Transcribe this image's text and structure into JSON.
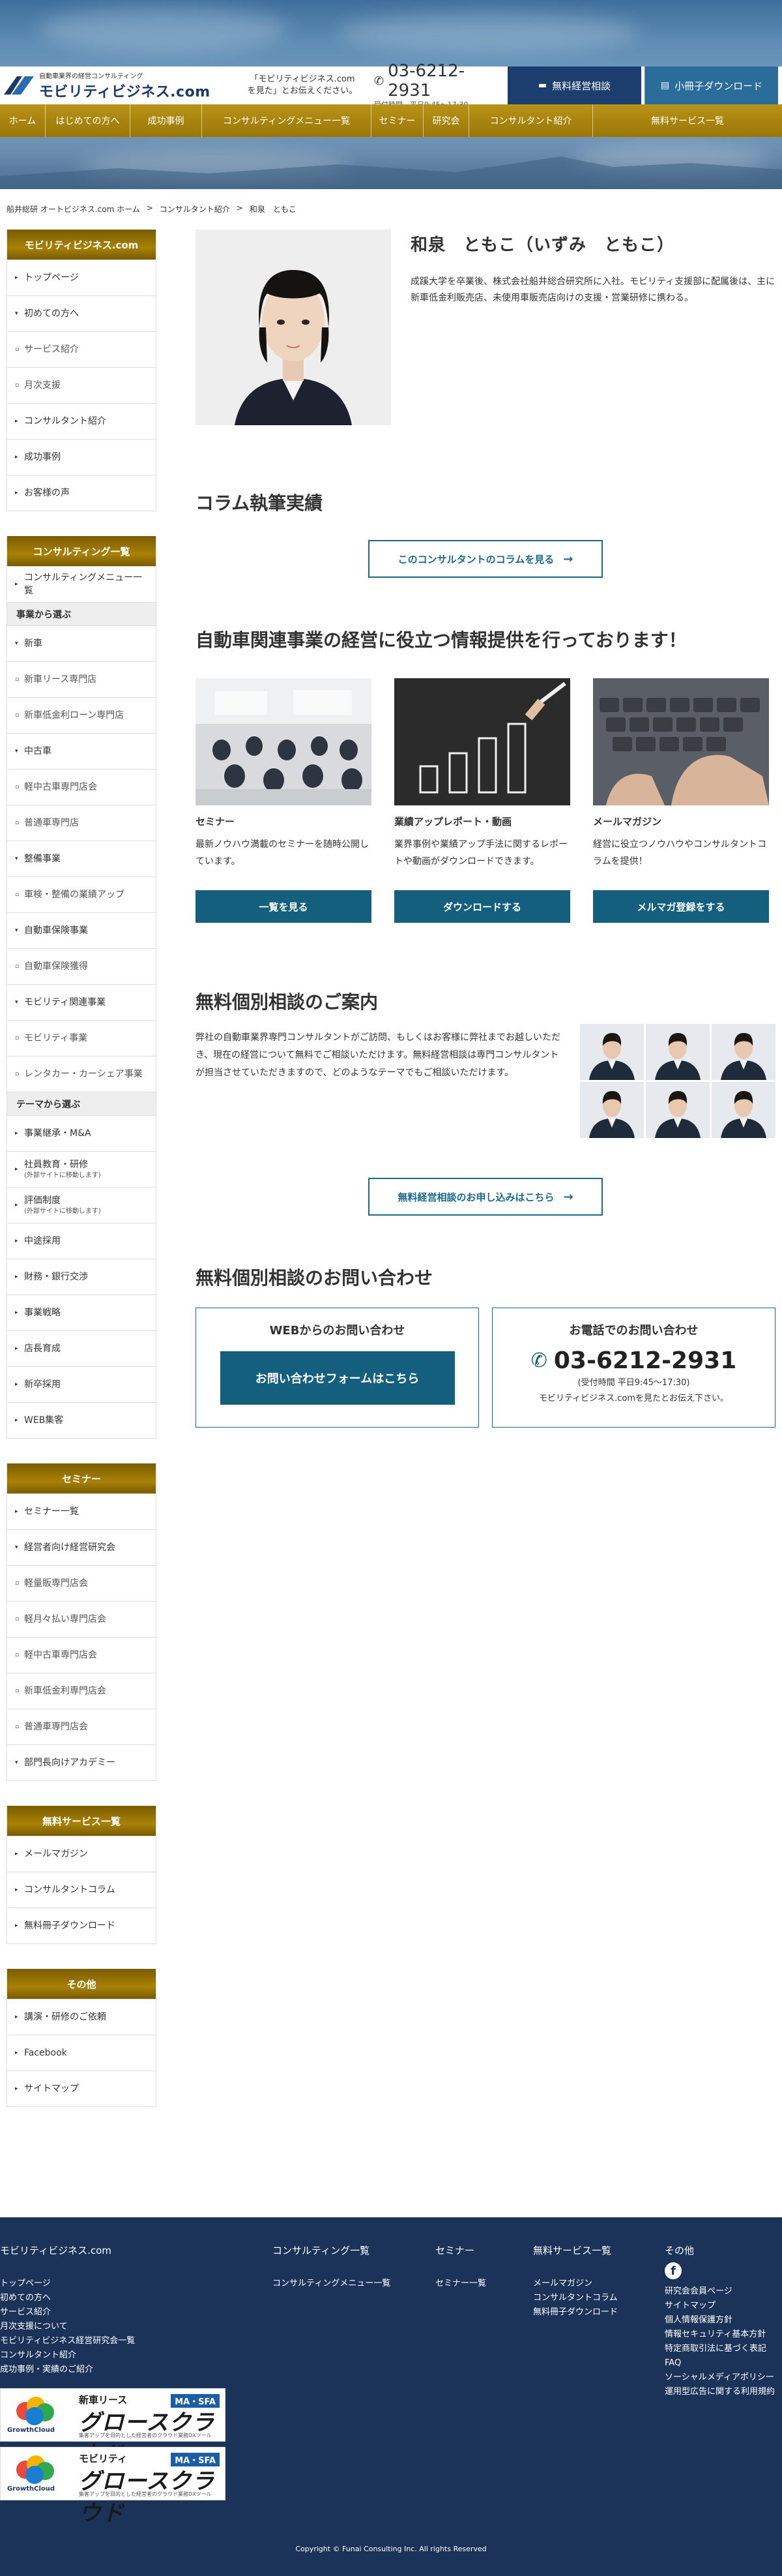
{
  "header": {
    "logo_sub": "自動車業界の経営コンサルティング",
    "logo_main": "モビリティビジネス.com",
    "note_line1": "「モビリティビジネス.com",
    "note_line2": "を見た」とお伝えください。",
    "tel": "03-6212-2931",
    "hours": "受付時間　平日9:45〜17:30",
    "consult_btn": "無料経営相談",
    "dl_btn": "小冊子ダウンロード"
  },
  "gnav": [
    "ホーム",
    "はじめての方へ",
    "成功事例",
    "コンサルティングメニュー一覧",
    "セミナー",
    "研究会",
    "コンサルタント紹介",
    "無料サービス一覧"
  ],
  "breadcrumb": [
    "船井総研 オートビジネス.com ホーム",
    ">",
    "コンサルタント紹介",
    ">",
    "和泉　ともこ"
  ],
  "sidebar": {
    "main_head": "モビリティビジネス.com",
    "main_items": [
      {
        "label": "トップページ",
        "mk": "▸"
      },
      {
        "label": "初めての方へ",
        "mk": "▾"
      },
      {
        "label": "サービス紹介",
        "mk": "▫",
        "sub": true
      },
      {
        "label": "月次支援",
        "mk": "▫",
        "sub": true
      },
      {
        "label": "コンサルタント紹介",
        "mk": "▸"
      },
      {
        "label": "成功事例",
        "mk": "▸"
      },
      {
        "label": "お客様の声",
        "mk": "▸"
      }
    ],
    "consult_head": "コンサルティング一覧",
    "consult_top": "コンサルティングメニュー一覧",
    "cat_business": "事業から選ぶ",
    "business_items": [
      {
        "label": "新車",
        "mk": "▾"
      },
      {
        "label": "新車リース専門店",
        "mk": "▫",
        "sub": true
      },
      {
        "label": "新車低金利ローン専門店",
        "mk": "▫",
        "sub": true
      },
      {
        "label": "中古車",
        "mk": "▾"
      },
      {
        "label": "軽中古車専門店会",
        "mk": "▫",
        "sub": true
      },
      {
        "label": "普通車専門店",
        "mk": "▫",
        "sub": true
      },
      {
        "label": "整備事業",
        "mk": "▾"
      },
      {
        "label": "車検・整備の業績アップ",
        "mk": "▫",
        "sub": true
      },
      {
        "label": "自動車保険事業",
        "mk": "▾"
      },
      {
        "label": "自動車保険獲得",
        "mk": "▫",
        "sub": true
      },
      {
        "label": "モビリティ関連事業",
        "mk": "▾"
      },
      {
        "label": "モビリティ事業",
        "mk": "▫",
        "sub": true
      },
      {
        "label": "レンタカー・カーシェア事業",
        "mk": "▫",
        "sub": true
      }
    ],
    "cat_theme": "テーマから選ぶ",
    "theme_items": [
      {
        "label": "事業継承・M&A",
        "mk": "▸"
      },
      {
        "label": "社員教育・研修",
        "note": "(外部サイトに移動します)",
        "mk": "▸"
      },
      {
        "label": "評価制度",
        "note": "(外部サイトに移動します)",
        "mk": "▸"
      },
      {
        "label": "中途採用",
        "mk": "▸"
      },
      {
        "label": "財務・銀行交渉",
        "mk": "▸"
      },
      {
        "label": "事業戦略",
        "mk": "▸"
      },
      {
        "label": "店長育成",
        "mk": "▸"
      },
      {
        "label": "新卒採用",
        "mk": "▸"
      },
      {
        "label": "WEB集客",
        "mk": "▸"
      }
    ],
    "seminar_head": "セミナー",
    "seminar_items": [
      {
        "label": "セミナー一覧",
        "mk": "▸"
      },
      {
        "label": "経営者向け経営研究会",
        "mk": "▾"
      },
      {
        "label": "軽量販専門店会",
        "mk": "▫",
        "sub": true
      },
      {
        "label": "軽月々払い専門店会",
        "mk": "▫",
        "sub": true
      },
      {
        "label": "軽中古車専門店会",
        "mk": "▫",
        "sub": true
      },
      {
        "label": "新車低金利専門店会",
        "mk": "▫",
        "sub": true
      },
      {
        "label": "普通車専門店会",
        "mk": "▫",
        "sub": true
      },
      {
        "label": "部門長向けアカデミー",
        "mk": "▾"
      }
    ],
    "free_head": "無料サービス一覧",
    "free_items": [
      {
        "label": "メールマガジン",
        "mk": "▸"
      },
      {
        "label": "コンサルタントコラム",
        "mk": "▸"
      },
      {
        "label": "無料冊子ダウンロード",
        "mk": "▸"
      }
    ],
    "other_head": "その他",
    "other_items": [
      {
        "label": "講演・研修のご依頼",
        "mk": "▸"
      },
      {
        "label": "Facebook",
        "mk": "▸"
      },
      {
        "label": "サイトマップ",
        "mk": "▸"
      }
    ]
  },
  "profile": {
    "name": "和泉　ともこ（いずみ　ともこ）",
    "bio": "成蹊大学を卒業後、株式会社船井総合研究所に入社。モビリティ支援部に配属後は、主に新車低金利販売店、未使用車販売店向けの支援・営業研修に携わる。"
  },
  "column": {
    "title": "コラム執筆実績",
    "btn": "このコンサルタントのコラムを見る"
  },
  "info": {
    "title": "自動車関連事業の経営に役立つ情報提供を行っております！",
    "cards": [
      {
        "title": "セミナー",
        "desc": "最新ノウハウ満載のセミナーを随時公開しています。",
        "btn": "一覧を見る"
      },
      {
        "title": "業績アップレポート・動画",
        "desc": "業界事例や業績アップ手法に関するレポートや動画がダウンロードできます。",
        "btn": "ダウンロードする"
      },
      {
        "title": "メールマガジン",
        "desc": "経営に役立つノウハウやコンサルタントコラムを提供！",
        "btn": "メルマガ登録をする"
      }
    ]
  },
  "consult": {
    "title": "無料個別相談のご案内",
    "text": "弊社の自動車業界専門コンサルタントがご訪問、もしくはお客様に弊社までお越しいただき、現在の経営について無料でご相談いただけます。無料経営相談は専門コンサルタントが担当させていただきますので、どのようなテーマでもご相談いただけます。",
    "btn": "無料経営相談のお申し込みはこちら"
  },
  "inquiry": {
    "title": "無料個別相談のお問い合わせ",
    "web_title": "WEBからのお問い合わせ",
    "web_btn": "お問い合わせフォームはこちら",
    "tel_title": "お電話でのお問い合わせ",
    "tel": "03-6212-2931",
    "tel_hours": "(受付時間 平日9:45〜17:30)",
    "tel_note": "モビリティビジネス.comを見たとお伝え下さい。"
  },
  "footer": {
    "col1_head": "モビリティビジネス.com",
    "col1_links": [
      "トップページ",
      "初めての方へ",
      "サービス紹介",
      "月次支援について",
      "モビリティビジネス経営研究会一覧",
      "コンサルタント紹介",
      "成功事例・実績のご紹介"
    ],
    "col2_head": "コンサルティング一覧",
    "col2_links": [
      "コンサルティングメニュー一覧"
    ],
    "col3_head": "セミナー",
    "col3_links": [
      "セミナー一覧"
    ],
    "col4_head": "無料サービス一覧",
    "col4_links": [
      "メールマガジン",
      "コンサルタントコラム",
      "無料冊子ダウンロード"
    ],
    "col5_head": "その他",
    "col5_links": [
      "研究会会員ページ",
      "サイトマップ",
      "個人情報保護方針",
      "情報セキュリティ基本方針",
      "特定商取引法に基づく表記",
      "FAQ",
      "ソーシャルメディアポリシー",
      "運用型広告に関する利用規約"
    ],
    "banners": [
      {
        "sub": "新車リース",
        "main": "グロースクラウド",
        "tag": "MA・SFA",
        "cap": "集客アップを目的とした経営者のクラウド業務DXツール",
        "gc": "GrowthCloud"
      },
      {
        "sub": "モビリティ",
        "main": "グロースクラウド",
        "tag": "MA・SFA",
        "cap": "集客アップを目的とした経営者のクラウド業務DXツール",
        "gc": "GrowthCloud"
      }
    ],
    "copyright": "Copyright © Funai Consulting Inc. All rights Reserved"
  },
  "colors": {
    "gold": "#a88106",
    "navy": "#1b3359",
    "teal": "#135f7d"
  }
}
